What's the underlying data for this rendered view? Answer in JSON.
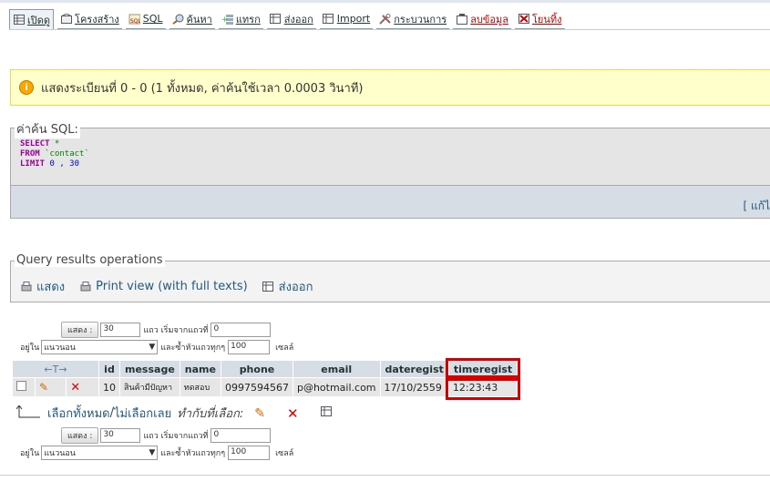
{
  "tabs": [
    {
      "label": "เปิดดู",
      "icon": "browse-icon",
      "active": true
    },
    {
      "label": "โครงสร้าง",
      "icon": "structure-icon"
    },
    {
      "label": "SQL",
      "icon": "sql-icon"
    },
    {
      "label": "ค้นหา",
      "icon": "search-icon"
    },
    {
      "label": "แทรก",
      "icon": "insert-icon"
    },
    {
      "label": "ส่งออก",
      "icon": "export-icon"
    },
    {
      "label": "Import",
      "icon": "import-icon"
    },
    {
      "label": "กระบวนการ",
      "icon": "operations-icon"
    },
    {
      "label": "ลบข้อมูล",
      "icon": "empty-icon",
      "danger": true
    },
    {
      "label": "โยนทิ้ง",
      "icon": "drop-icon",
      "danger": true
    }
  ],
  "notice": {
    "text": "แสดงระเบียนที่ 0 - 0 (1 ทั้งหมด, ค่าค้นใช้เวลา 0.0003 วินาที)"
  },
  "sql": {
    "legend": "ค่าค้น SQL:",
    "select_kw": "SELECT",
    "select_rest": " * ",
    "from_kw": "FROM",
    "from_rest": " `contact`",
    "limit_kw": "LIMIT",
    "limit_rest": " 0 , 30",
    "edit_link": "[ แก้ไ"
  },
  "ops": {
    "legend": "Query results operations",
    "show": "แสดง",
    "print": "Print view (with full texts)",
    "export": "ส่งออก"
  },
  "nav": {
    "show_btn": "แสดง :",
    "rows_value": "30",
    "rows_label": "แถว เริ่มจากแถวที่",
    "start_value": "0",
    "mode_prefix": "อยู่ใน",
    "mode_value": "แนวนอน",
    "repeat_label": "และซ้ำหัวแถวทุกๆ",
    "repeat_value": "100",
    "cells_label": "เซลล์"
  },
  "table": {
    "sort_arrows": "←T→",
    "headers": [
      "id",
      "message",
      "name",
      "phone",
      "email",
      "dateregist",
      "timeregist"
    ],
    "rows": [
      [
        "10",
        "สินค้ามีปัญหา",
        "ทดสอบ",
        "0997594567",
        "p@hotmail.com",
        "17/10/2559",
        "12:23:43"
      ]
    ]
  },
  "bulk": {
    "select_all": "เลือกทั้งหมด",
    "separator": " / ",
    "deselect_all": "ไม่เลือกเลย",
    "with_selected": "ทำกับที่เลือก:"
  }
}
